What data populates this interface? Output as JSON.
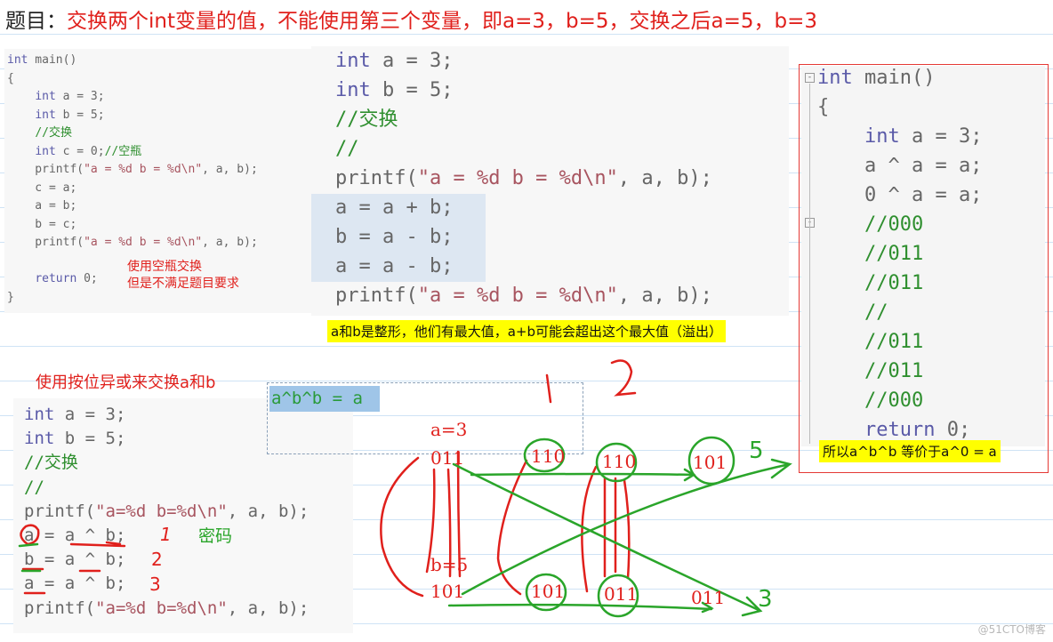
{
  "title": {
    "label": "题目：",
    "question": "交换两个int变量的值，不能使用第三个变量，即a=3，b=5，交换之后a=5，b=3"
  },
  "panel_temp": {
    "lines": [
      [
        [
          "kw",
          "int"
        ],
        [
          "id",
          " main()"
        ]
      ],
      [
        [
          "id",
          "{"
        ]
      ],
      [
        [
          "id",
          "    "
        ],
        [
          "kw",
          "int"
        ],
        [
          "id",
          " a = 3;"
        ]
      ],
      [
        [
          "id",
          "    "
        ],
        [
          "kw",
          "int"
        ],
        [
          "id",
          " b = 5;"
        ]
      ],
      [
        [
          "id",
          "    "
        ],
        [
          "cm",
          "//交换"
        ]
      ],
      [
        [
          "id",
          "    "
        ],
        [
          "kw",
          "int"
        ],
        [
          "id",
          " c = 0;"
        ],
        [
          "cm",
          "//空瓶"
        ]
      ],
      [
        [
          "id",
          "    printf("
        ],
        [
          "str",
          "\"a = %d b = %d\\n\""
        ],
        [
          "id",
          ", a, b);"
        ]
      ],
      [
        [
          "id",
          "    c = a;"
        ]
      ],
      [
        [
          "id",
          "    a = b;"
        ]
      ],
      [
        [
          "id",
          "    b = c;"
        ]
      ],
      [
        [
          "id",
          "    printf("
        ],
        [
          "str",
          "\"a = %d b = %d\\n\""
        ],
        [
          "id",
          ", a, b);"
        ]
      ],
      [
        [
          "id",
          ""
        ]
      ],
      [
        [
          "id",
          "    "
        ],
        [
          "kw",
          "return"
        ],
        [
          "id",
          " 0;"
        ]
      ],
      [
        [
          "id",
          "}"
        ]
      ]
    ],
    "note": [
      "使用空瓶交换",
      "但是不满足题目要求"
    ]
  },
  "panel_add": {
    "lines": [
      [
        [
          "kw",
          "int"
        ],
        [
          "id",
          " a = 3;"
        ]
      ],
      [
        [
          "kw",
          "int"
        ],
        [
          "id",
          " b = 5;"
        ]
      ],
      [
        [
          "cm",
          "//交换"
        ]
      ],
      [
        [
          "cm",
          "//"
        ]
      ],
      [
        [
          "id",
          "printf("
        ],
        [
          "str",
          "\"a = %d b = %d\\n\""
        ],
        [
          "id",
          ", a, b);"
        ]
      ],
      [
        [
          "id",
          "a = a + b;"
        ]
      ],
      [
        [
          "id",
          "b = a - b;"
        ]
      ],
      [
        [
          "id",
          "a = a - b;"
        ]
      ],
      [
        [
          "id",
          "printf("
        ],
        [
          "str",
          "\"a = %d b = %d\\n\""
        ],
        [
          "id",
          ", a, b);"
        ]
      ]
    ],
    "note": "a和b是整形，他们有最大值，a+b可能会超出这个最大值（溢出）"
  },
  "panel_right": {
    "lines": [
      [
        [
          "kw",
          "int"
        ],
        [
          "id",
          " main()"
        ]
      ],
      [
        [
          "id",
          "{"
        ]
      ],
      [
        [
          "id",
          "    "
        ],
        [
          "kw",
          "int"
        ],
        [
          "id",
          " a = 3;"
        ]
      ],
      [
        [
          "id",
          "    a ^ a = a;"
        ]
      ],
      [
        [
          "id",
          "    0 ^ a = a;"
        ]
      ],
      [
        [
          "id",
          "    "
        ],
        [
          "cm",
          "//000"
        ]
      ],
      [
        [
          "id",
          "    "
        ],
        [
          "cm",
          "//011"
        ]
      ],
      [
        [
          "id",
          "    "
        ],
        [
          "cm",
          "//011"
        ]
      ],
      [
        [
          "id",
          "    "
        ],
        [
          "cm",
          "//"
        ]
      ],
      [
        [
          "id",
          "    "
        ],
        [
          "cm",
          "//011"
        ]
      ],
      [
        [
          "id",
          "    "
        ],
        [
          "cm",
          "//011"
        ]
      ],
      [
        [
          "id",
          "    "
        ],
        [
          "cm",
          "//000"
        ]
      ],
      [
        [
          "id",
          "    "
        ],
        [
          "kw",
          "return"
        ],
        [
          "id",
          " 0;"
        ]
      ]
    ],
    "note": "所以a^b^b 等价于a^0 = a",
    "border_color": "#e53935"
  },
  "xor_section": {
    "heading": "使用按位异或来交换a和b",
    "lines": [
      [
        [
          "kw",
          "int"
        ],
        [
          "id",
          " a = 3;"
        ]
      ],
      [
        [
          "kw",
          "int"
        ],
        [
          "id",
          " b = 5;"
        ]
      ],
      [
        [
          "cm",
          "//交换"
        ]
      ],
      [
        [
          "cm",
          "//"
        ]
      ],
      [
        [
          "id",
          "printf("
        ],
        [
          "str",
          "\"a=%d b=%d\\n\""
        ],
        [
          "id",
          ", a, b);"
        ]
      ],
      [
        [
          "id",
          "a = a ^ b;"
        ]
      ],
      [
        [
          "id",
          "b = a ^ b;"
        ]
      ],
      [
        [
          "id",
          "a = a ^ b;"
        ]
      ],
      [
        [
          "id",
          "printf("
        ],
        [
          "str",
          "\"a=%d b=%d\\n\""
        ],
        [
          "id",
          ", a, b);"
        ]
      ]
    ],
    "formula": "a^b^b = a",
    "annotations": {
      "mark1": "1",
      "mark2": "2",
      "mark3": "3",
      "key": "密码"
    }
  },
  "drawing": {
    "a_label": "a=3",
    "a_bin": "011",
    "b_label": "b=5",
    "b_bin": "101",
    "step1_top": "110",
    "step1_bottom": "101",
    "step2_top": "110",
    "step2_bottom": "011",
    "result_top": "101",
    "result_bottom": "011",
    "result_top_value": "5",
    "result_bottom_value": "3",
    "step_mark1": "1",
    "step_mark2": "2"
  },
  "watermark": "@51CTO博客",
  "colors": {
    "red": "#e0201c",
    "green": "#2aa52a",
    "highlight": "#ffff00"
  }
}
